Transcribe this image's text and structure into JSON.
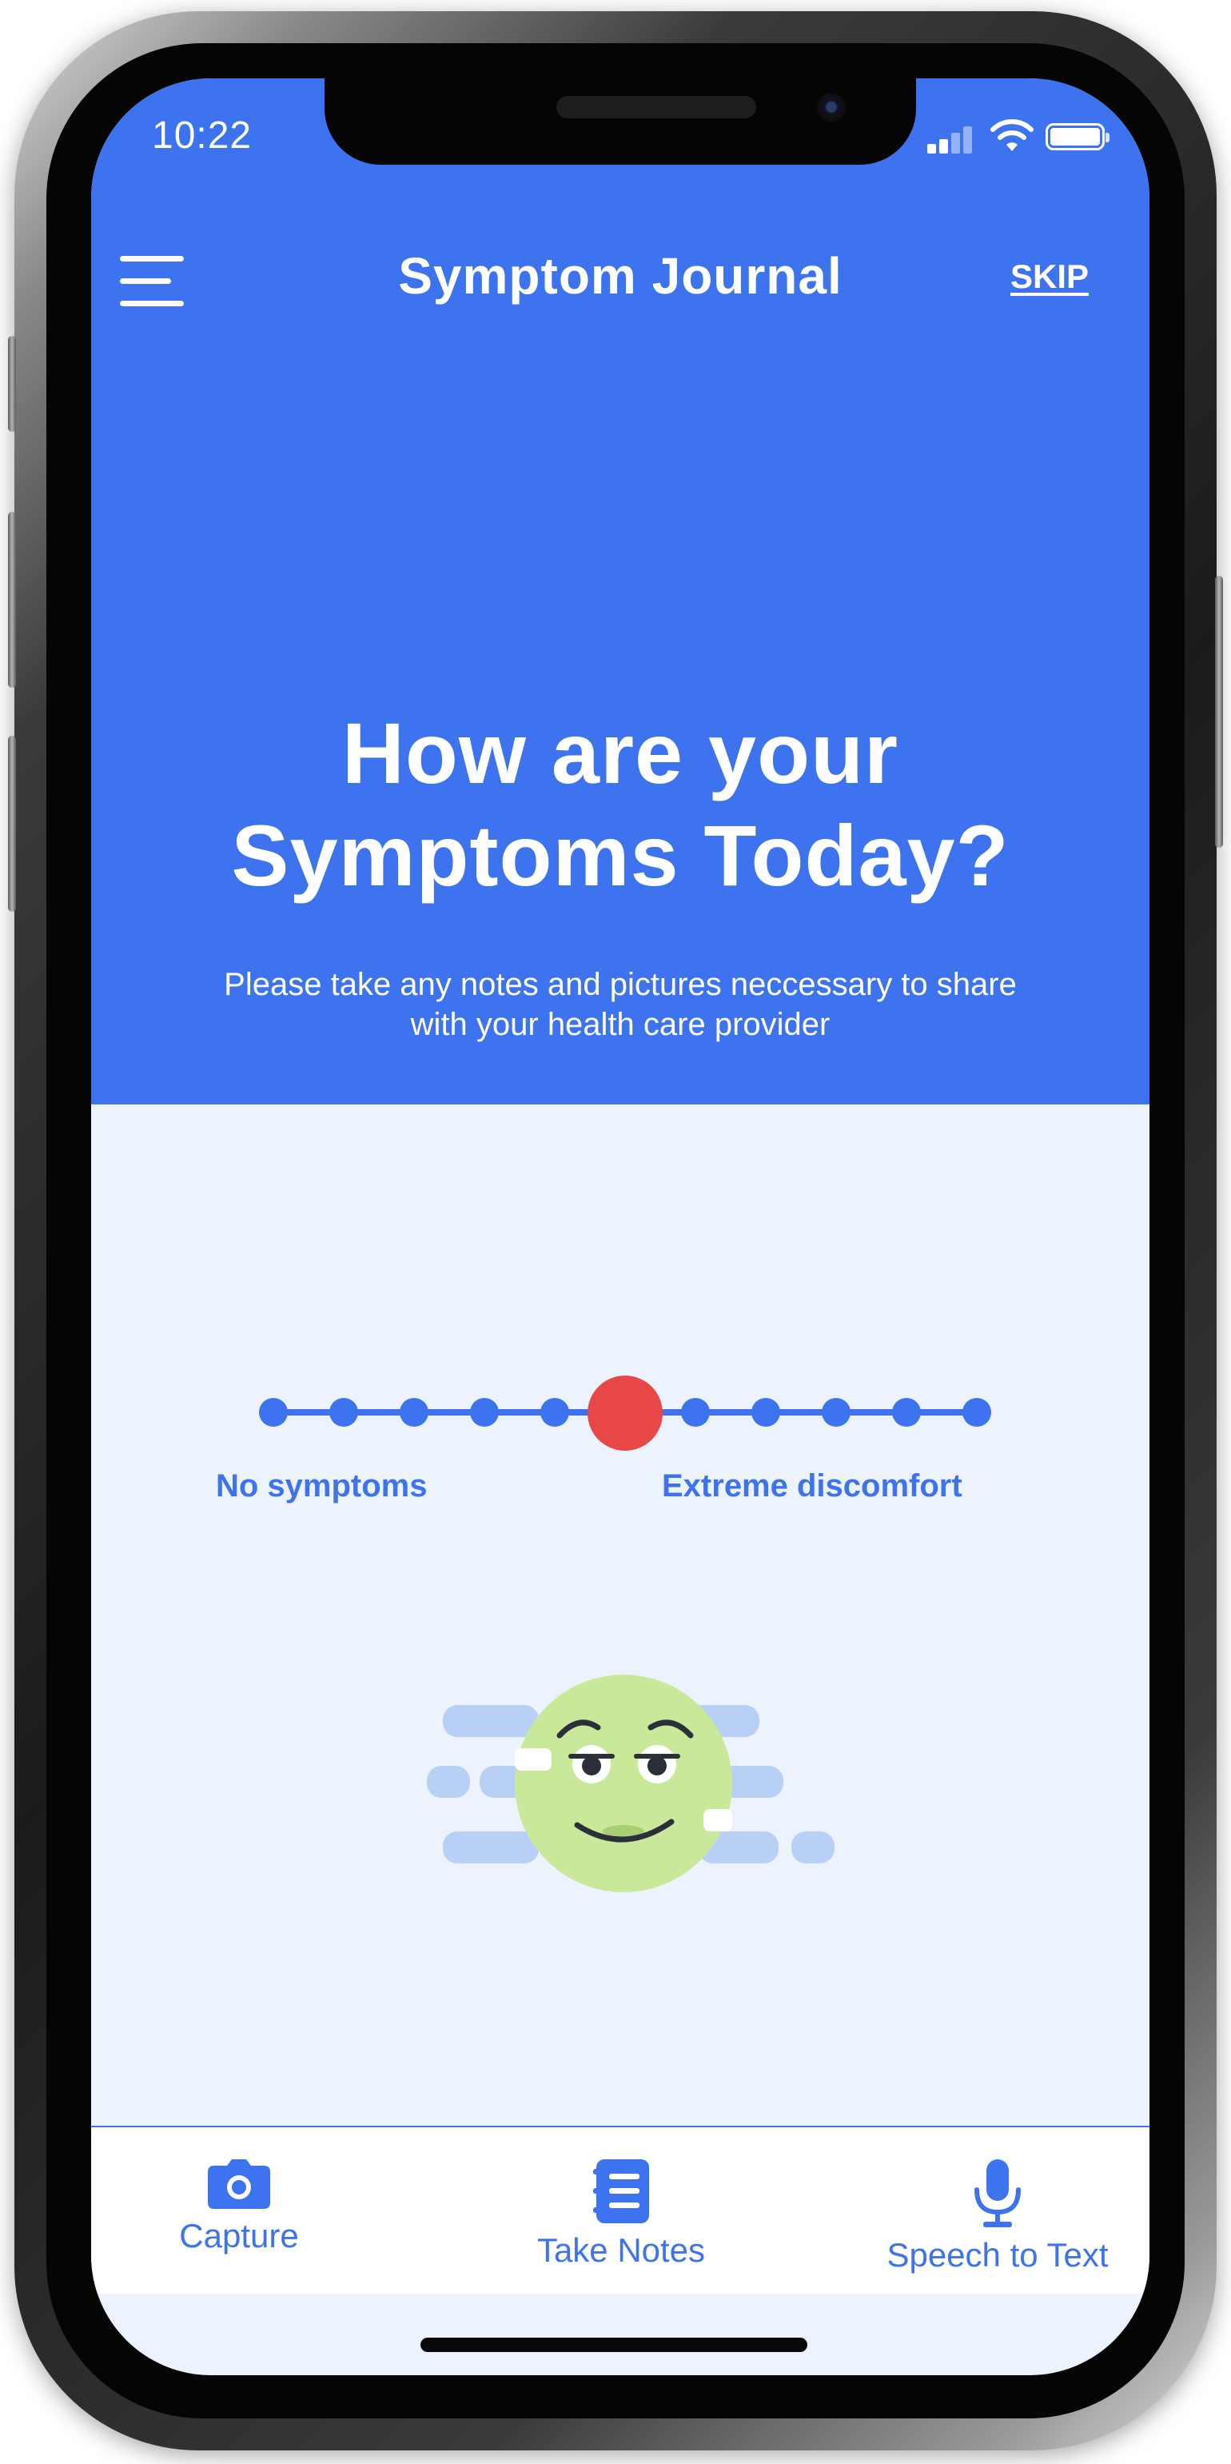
{
  "status_bar": {
    "time": "10:22"
  },
  "header": {
    "title": "Symptom Journal",
    "skip_label": "SKIP"
  },
  "hero": {
    "heading_line1": "How are your",
    "heading_line2": "Symptoms Today?",
    "subtitle_line1": "Please take any notes and pictures neccessary to share",
    "subtitle_line2": "with your health care provider"
  },
  "slider": {
    "min_label": "No symptoms",
    "max_label": "Extreme discomfort",
    "steps": 11,
    "selected_index": 5
  },
  "tabs": [
    {
      "label": "Capture",
      "icon": "camera-icon"
    },
    {
      "label": "Take Notes",
      "icon": "notes-icon"
    },
    {
      "label": "Speech to Text",
      "icon": "microphone-icon"
    }
  ],
  "colors": {
    "primary": "#3d73ef",
    "background": "#edf3fc",
    "thumb": "#e84747",
    "face": "#c9e89a"
  }
}
